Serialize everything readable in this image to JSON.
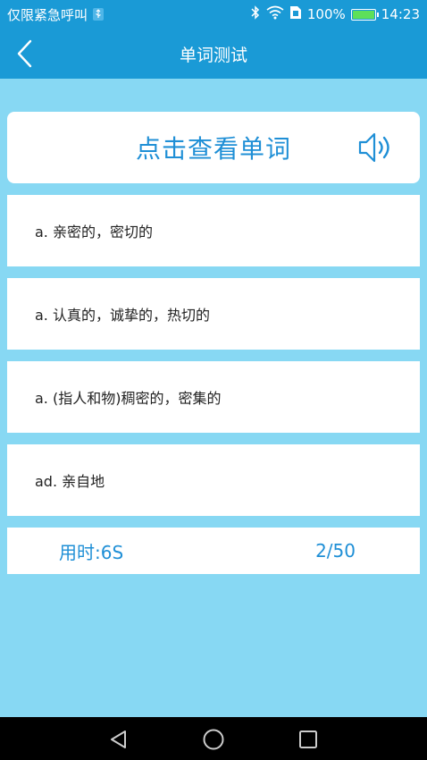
{
  "status": {
    "carrier": "仅限紧急呼叫",
    "battery": "100%",
    "time": "14:23"
  },
  "header": {
    "title": "单词测试"
  },
  "word_card": {
    "prompt": "点击查看单词"
  },
  "options": [
    "a. 亲密的，密切的",
    "a. 认真的，诚挚的，热切的",
    "a. (指人和物)稠密的，密集的",
    "ad. 亲自地"
  ],
  "footer": {
    "elapsed": "用时:6S",
    "progress": "2/50"
  },
  "colors": {
    "bar_blue": "#1a9ad6",
    "page_bg": "#87d8f3",
    "accent_text": "#1f8fd6"
  }
}
